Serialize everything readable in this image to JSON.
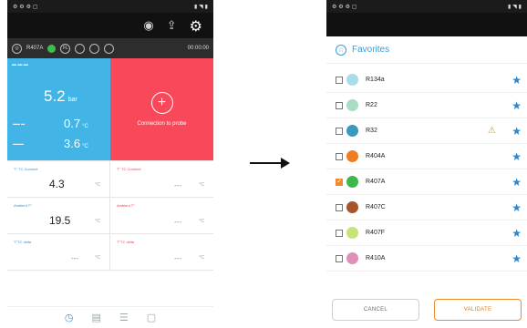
{
  "left": {
    "toolbar": {
      "icons": [
        "camera-icon",
        "share-icon",
        "gear-icon"
      ]
    },
    "probebar": {
      "refrigerant": "R407A",
      "probe2": "FL",
      "time": "00:00:00"
    },
    "pressure_tile": {
      "value": "5.2",
      "unit": "bar",
      "sub1_value": "0.7",
      "sub1_unit": "°C",
      "sub2_value": "3.6",
      "sub2_unit": "°C"
    },
    "connection_tile": {
      "label": "Connection to probe"
    },
    "cells": [
      {
        "label": "T° TC Connect",
        "value": "4.3",
        "unit": "°C"
      },
      {
        "label": "T° TC Connect",
        "value": "---",
        "unit": "°C"
      },
      {
        "label": "Ambient T°",
        "value": "19.5",
        "unit": "°C"
      },
      {
        "label": "Ambient T°",
        "value": "---",
        "unit": "°C"
      },
      {
        "label": "T°TC delta",
        "value": "---",
        "unit": "°C"
      },
      {
        "label": "T°TC delta",
        "value": "---",
        "unit": "°C"
      }
    ]
  },
  "right": {
    "header": {
      "title": "Favorites"
    },
    "refrigerants": [
      {
        "name": "R134a",
        "color": "#a7dce8",
        "checked": false,
        "warning": false
      },
      {
        "name": "R22",
        "color": "#a8dcc4",
        "checked": false,
        "warning": false
      },
      {
        "name": "R32",
        "color": "#3b98c2",
        "checked": false,
        "warning": true
      },
      {
        "name": "R404A",
        "color": "#ef7d22",
        "checked": false,
        "warning": false
      },
      {
        "name": "R407A",
        "color": "#3fb84a",
        "checked": true,
        "warning": false
      },
      {
        "name": "R407C",
        "color": "#a5552c",
        "checked": false,
        "warning": false
      },
      {
        "name": "R407F",
        "color": "#c8e27a",
        "checked": false,
        "warning": false
      },
      {
        "name": "R410A",
        "color": "#e08fb8",
        "checked": false,
        "warning": false
      }
    ],
    "footer": {
      "cancel": "CANCEL",
      "validate": "VALIDATE"
    }
  }
}
